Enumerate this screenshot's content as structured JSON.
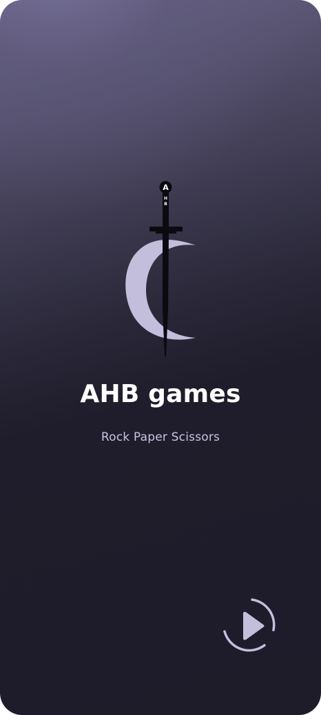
{
  "splash": {
    "title": "AHB games",
    "subtitle": "Rock Paper Scissors",
    "logo": {
      "hilt_letters": [
        "A",
        "H",
        "B"
      ],
      "icon": "sword-crescent-logo"
    },
    "play_button": {
      "icon": "play-icon"
    }
  },
  "colors": {
    "accent": "#c3bedc",
    "title": "#ffffff",
    "subtitle": "#c9c4e3",
    "background_dark": "#1e1c29",
    "background_light": "#6b6687"
  }
}
